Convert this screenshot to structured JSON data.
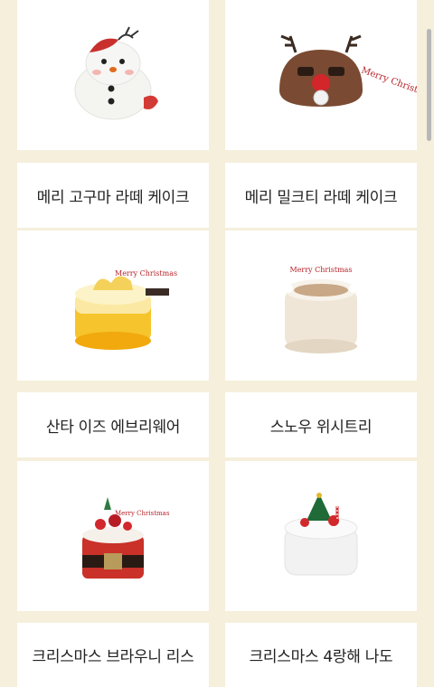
{
  "products": [
    {
      "name": "메리 고구마 라떼 케이크",
      "image": "snowman-cake-icon"
    },
    {
      "name": "메리 밀크티 라떼 케이크",
      "image": "reindeer-cake-icon"
    },
    {
      "name": "산타 이즈 에브리웨어",
      "image": "yellow-cake-icon"
    },
    {
      "name": "스노우 위시트리",
      "image": "white-cake-icon"
    },
    {
      "name": "크리스마스 브라우니 리스",
      "image": "red-belt-cake-icon"
    },
    {
      "name": "크리스마스 4랑해 나도",
      "image": "tree-cake-icon"
    }
  ],
  "decor_text": {
    "merry_christmas": "Merry Christmas"
  }
}
